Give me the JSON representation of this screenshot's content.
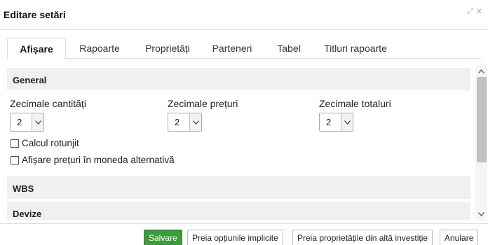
{
  "dialog": {
    "title": "Editare setări",
    "expand_icon": "⤢",
    "close_icon": "✕"
  },
  "tabs": [
    {
      "label": "Afișare",
      "active": true
    },
    {
      "label": "Rapoarte"
    },
    {
      "label": "Proprietăți"
    },
    {
      "label": "Parteneri"
    },
    {
      "label": "Tabel"
    },
    {
      "label": "Titluri rapoarte"
    }
  ],
  "sections": {
    "general": {
      "title": "General",
      "fields": [
        {
          "label": "Zecimale cantități",
          "value": "2"
        },
        {
          "label": "Zecimale prețuri",
          "value": "2"
        },
        {
          "label": "Zecimale totaluri",
          "value": "2"
        }
      ],
      "checkboxes": [
        {
          "label": "Calcul rotunjit",
          "checked": false
        },
        {
          "label": "Afișare prețuri în moneda alternativă",
          "checked": false
        }
      ]
    },
    "wbs": {
      "title": "WBS"
    },
    "devize": {
      "title": "Devize"
    }
  },
  "footer": {
    "save": "Salvare",
    "default_options": "Preia opțiunile implicite",
    "copy_properties": "Preia proprietățile din altă investiție",
    "cancel": "Anulare"
  },
  "colors": {
    "primary_button": "#3c9b3c",
    "section_header_bg": "#f0f0f0"
  }
}
